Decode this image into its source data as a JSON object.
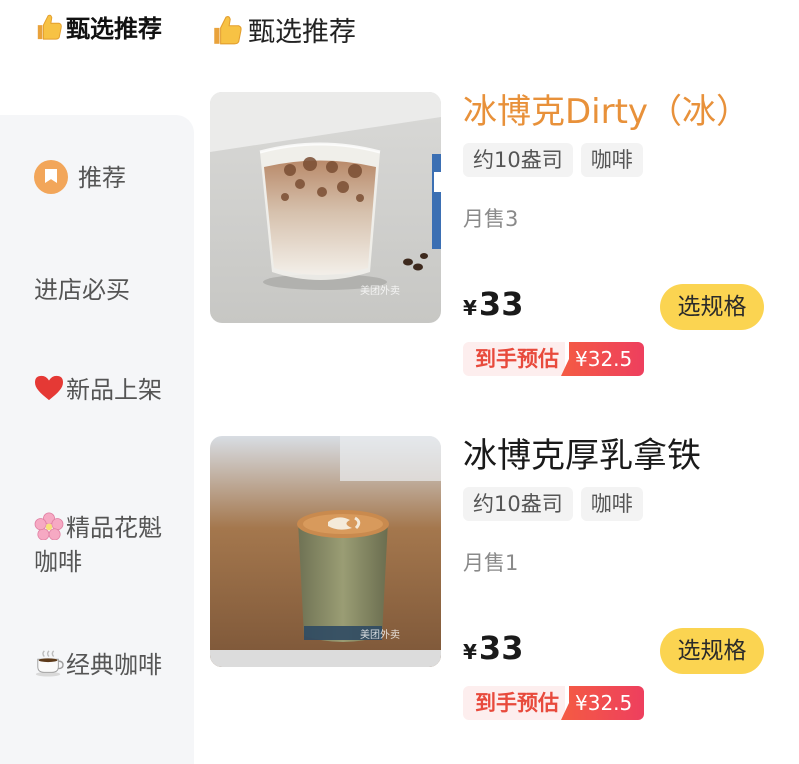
{
  "sidebar": {
    "active": {
      "icon": "thumbs-up-icon",
      "label": "甄选推荐"
    },
    "items": [
      {
        "icon": "recommend-badge-icon",
        "label": "推荐"
      },
      {
        "icon": "",
        "label": "进店必买"
      },
      {
        "icon": "red-heart-icon",
        "label": "新品上架"
      },
      {
        "icon": "cherry-blossom-icon",
        "label": "精品花魁咖啡"
      },
      {
        "icon": "hot-beverage-icon",
        "label": "经典咖啡"
      }
    ]
  },
  "section": {
    "icon": "thumbs-up-icon",
    "title": "甄选推荐"
  },
  "products": [
    {
      "name": "冰博克Dirty（冰）",
      "highlighted": true,
      "tags": [
        "约10盎司",
        "咖啡"
      ],
      "sales": "月售3",
      "currency": "¥",
      "price": "33",
      "button": "选规格",
      "estimate_label": "到手预估",
      "estimate_price": "¥32.5"
    },
    {
      "name": "冰博克厚乳拿铁",
      "highlighted": false,
      "tags": [
        "约10盎司",
        "咖啡"
      ],
      "sales": "月售1",
      "currency": "¥",
      "price": "33",
      "button": "选规格",
      "estimate_label": "到手预估",
      "estimate_price": "¥32.5"
    }
  ],
  "colors": {
    "highlight_name": "#e8913a",
    "spec_button": "#fbd451",
    "estimate_red": "#e84a3c",
    "sidebar_bg": "#f5f6f8"
  }
}
